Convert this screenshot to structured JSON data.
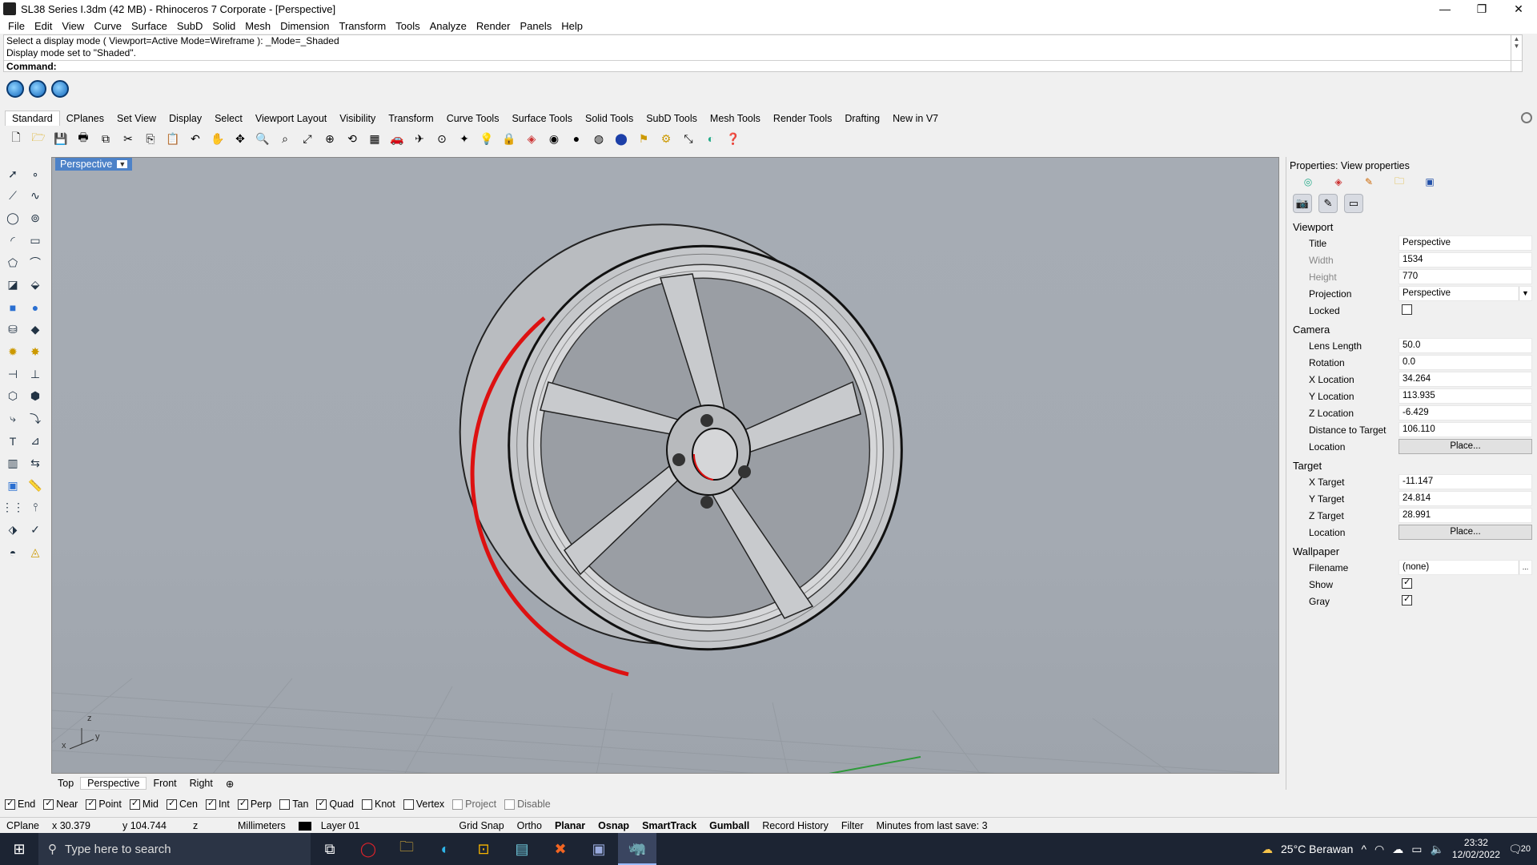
{
  "window": {
    "title": "SL38 Series I.3dm (42 MB) - Rhinoceros 7 Corporate - [Perspective]",
    "controls": [
      "—",
      "❐",
      "✕"
    ]
  },
  "menu": [
    "File",
    "Edit",
    "View",
    "Curve",
    "Surface",
    "SubD",
    "Solid",
    "Mesh",
    "Dimension",
    "Transform",
    "Tools",
    "Analyze",
    "Render",
    "Panels",
    "Help"
  ],
  "command": {
    "history1": "Select a display mode ( Viewport=Active  Mode=Wireframe ): _Mode=_Shaded",
    "history2": "Display mode set to \"Shaded\".",
    "prompt": "Command:"
  },
  "toolbar_tabs": [
    "Standard",
    "CPlanes",
    "Set View",
    "Display",
    "Select",
    "Viewport Layout",
    "Visibility",
    "Transform",
    "Curve Tools",
    "Surface Tools",
    "Solid Tools",
    "SubD Tools",
    "Mesh Tools",
    "Render Tools",
    "Drafting",
    "New in V7"
  ],
  "viewport": {
    "title": "Perspective",
    "axes": {
      "x": "x",
      "y": "y",
      "z": "z"
    }
  },
  "viewport_tabs": [
    "Top",
    "Perspective",
    "Front",
    "Right"
  ],
  "properties": {
    "header": "Properties: View properties",
    "viewport_section": "Viewport",
    "title_label": "Title",
    "title_value": "Perspective",
    "width_label": "Width",
    "width_value": "1534",
    "height_label": "Height",
    "height_value": "770",
    "projection_label": "Projection",
    "projection_value": "Perspective",
    "locked_label": "Locked",
    "camera_section": "Camera",
    "lens_label": "Lens Length",
    "lens_value": "50.0",
    "rotation_label": "Rotation",
    "rotation_value": "0.0",
    "xloc_label": "X Location",
    "xloc_value": "34.264",
    "yloc_label": "Y Location",
    "yloc_value": "113.935",
    "zloc_label": "Z Location",
    "zloc_value": "-6.429",
    "dist_label": "Distance to Target",
    "dist_value": "106.110",
    "loc_label": "Location",
    "place_button": "Place...",
    "target_section": "Target",
    "xt_label": "X Target",
    "xt_value": "-11.147",
    "yt_label": "Y Target",
    "yt_value": "24.814",
    "zt_label": "Z Target",
    "zt_value": "28.991",
    "tloc_label": "Location",
    "wallpaper_section": "Wallpaper",
    "filename_label": "Filename",
    "filename_value": "(none)",
    "browse": "...",
    "show_label": "Show",
    "gray_label": "Gray"
  },
  "osnaps": [
    {
      "label": "End",
      "checked": true
    },
    {
      "label": "Near",
      "checked": true
    },
    {
      "label": "Point",
      "checked": true
    },
    {
      "label": "Mid",
      "checked": true
    },
    {
      "label": "Cen",
      "checked": true
    },
    {
      "label": "Int",
      "checked": true
    },
    {
      "label": "Perp",
      "checked": true
    },
    {
      "label": "Tan",
      "checked": false
    },
    {
      "label": "Quad",
      "checked": true
    },
    {
      "label": "Knot",
      "checked": false
    },
    {
      "label": "Vertex",
      "checked": false
    },
    {
      "label": "Project",
      "checked": false
    },
    {
      "label": "Disable",
      "checked": false
    }
  ],
  "status": {
    "cplane": "CPlane",
    "x": "x 30.379",
    "y": "y 104.744",
    "z": "z",
    "units": "Millimeters",
    "layer": "Layer 01",
    "gridsnap": "Grid Snap",
    "ortho": "Ortho",
    "planar": "Planar",
    "osnap": "Osnap",
    "smarttrack": "SmartTrack",
    "gumball": "Gumball",
    "record": "Record History",
    "filter": "Filter",
    "save": "Minutes from last save: 3"
  },
  "taskbar": {
    "search_placeholder": "Type here to search",
    "weather": "25°C  Berawan",
    "time": "23:32",
    "date": "12/02/2022",
    "notif": "20"
  }
}
